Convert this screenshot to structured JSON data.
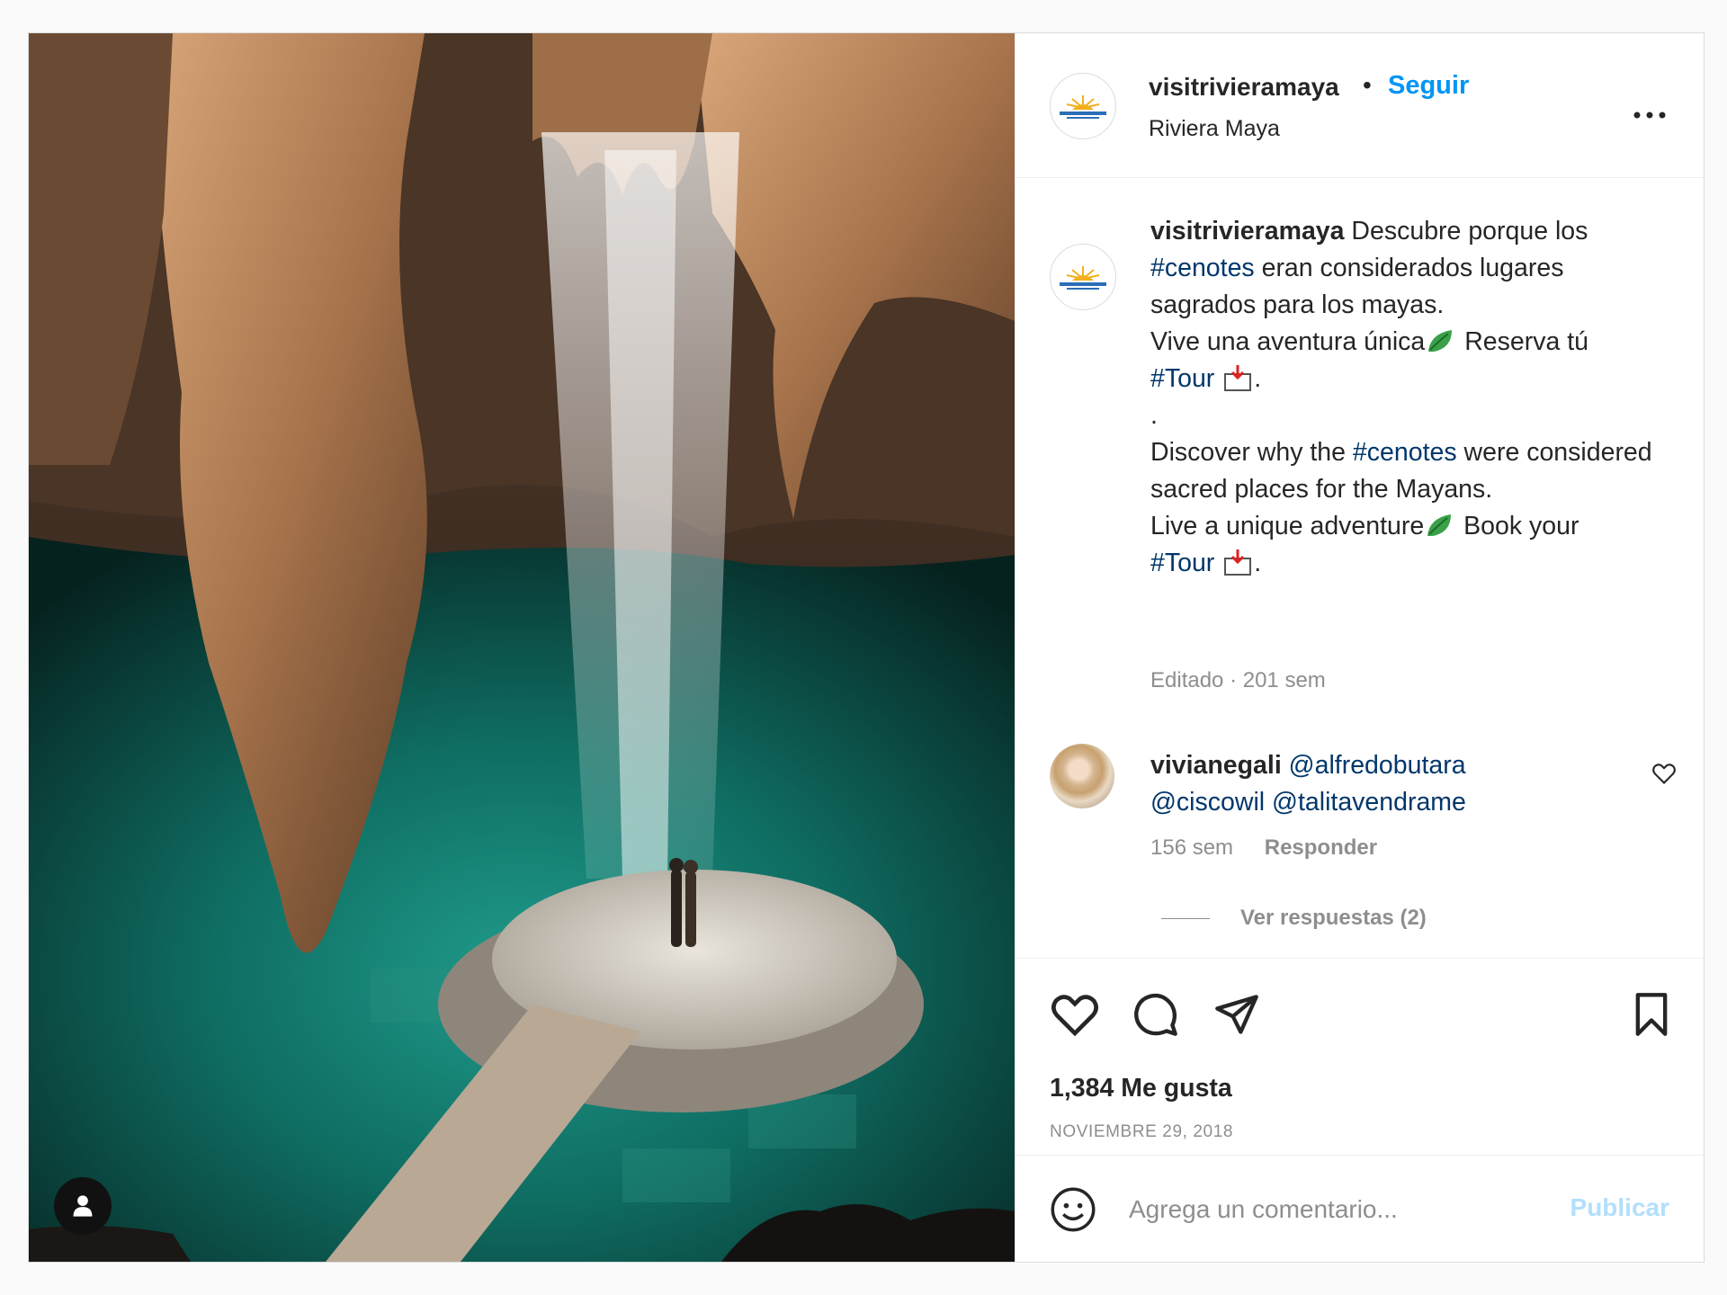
{
  "post": {
    "author": {
      "username": "visitrivieramaya",
      "separator": "•",
      "follow_label": "Seguir",
      "location": "Riviera Maya"
    },
    "more_icon": "more-horizontal-icon",
    "caption": {
      "username": "visitrivieramaya",
      "line1": "Descubre porque los",
      "tag_cenotes": "#cenotes",
      "line2": "eran considerados lugares sagrados para los mayas.",
      "line3": "Vive una aventura única",
      "line3b": "Reserva tú",
      "tag_tour": "#Tour",
      "period": ".",
      "dot_line": ".",
      "line4": "Discover why the",
      "line5": "were considered sacred places for the Mayans.",
      "line6": "Live a unique adventure",
      "line6b": "Book your",
      "time": "Editado · 201 sem"
    },
    "comment": {
      "username": "vivianegali",
      "mentions": [
        "@alfredobutara",
        "@ciscowil",
        "@talitavendrame"
      ],
      "time": "156 sem",
      "reply_label": "Responder",
      "view_replies": "Ver respuestas (2)"
    },
    "likes": "1,384 Me gusta",
    "date": "NOVIEMBRE 29, 2018",
    "add_comment": {
      "placeholder": "Agrega un comentario...",
      "publish_label": "Publicar"
    },
    "colors": {
      "link": "#0095f6",
      "hashtag": "#00376b",
      "publish_disabled": "#b2dffc",
      "muted": "#8e8e8e"
    }
  }
}
